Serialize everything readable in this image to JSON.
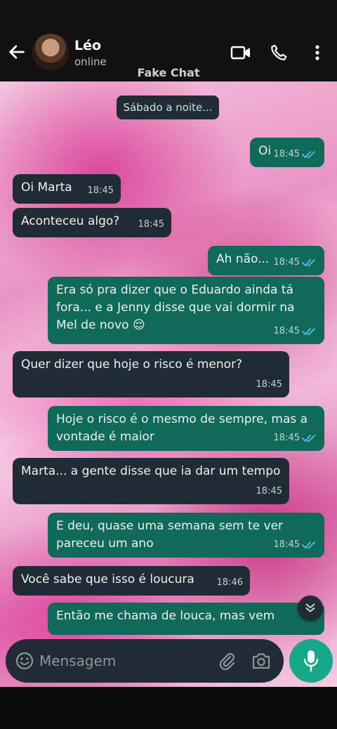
{
  "header": {
    "contact_name": "Léo",
    "status": "online",
    "watermark": "Fake Chat"
  },
  "chat": {
    "date_chip": "Sábado a noite...",
    "messages": [
      {
        "dir": "out",
        "text": "Oi",
        "time": "18:45",
        "read": true
      },
      {
        "dir": "in",
        "text": "Oi Marta",
        "time": "18:45"
      },
      {
        "dir": "in",
        "text": "Aconteceu algo?",
        "time": "18:45"
      },
      {
        "dir": "out",
        "text": "Ah não...",
        "time": "18:45",
        "read": true
      },
      {
        "dir": "out",
        "text": "Era só pra dizer que o Eduardo ainda tá fora... e a Jenny disse que vai dormir na Mel de novo 😌",
        "time": "18:45",
        "read": true
      },
      {
        "dir": "in",
        "text": "Quer dizer que hoje o risco é menor?",
        "time": "18:45"
      },
      {
        "dir": "out",
        "text": "Hoje o risco é o mesmo de sempre, mas a vontade é maior",
        "time": "18:45",
        "read": true
      },
      {
        "dir": "in",
        "text": "Marta... a gente disse que ia dar um tempo",
        "time": "18:45"
      },
      {
        "dir": "out",
        "text": "E deu, quase uma semana sem te ver pareceu um ano",
        "time": "18:45",
        "read": true
      },
      {
        "dir": "in",
        "text": "Você sabe que isso é loucura",
        "time": "18:46"
      },
      {
        "dir": "out",
        "text": "Então me chama de louca, mas vem",
        "time": "",
        "read": false
      }
    ]
  },
  "composer": {
    "placeholder": "Mensagem"
  },
  "icons": {
    "back": "arrow-left-icon",
    "video": "video-call-icon",
    "phone": "phone-icon",
    "menu": "more-vertical-icon",
    "emoji": "emoji-icon",
    "attach": "paperclip-icon",
    "camera": "camera-icon",
    "mic": "mic-icon",
    "scroll": "double-chevron-down-icon"
  },
  "colors": {
    "incoming_bubble": "#1f2c33",
    "outgoing_bubble": "#0f6b57",
    "mic_button": "#17a88a",
    "read_ticks": "#53bdeb"
  }
}
